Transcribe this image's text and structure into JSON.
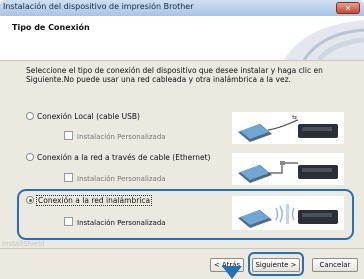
{
  "window": {
    "title": "Instalación del dispositivo de impresión Brother",
    "close_glyph": "✕"
  },
  "header": {
    "title": "Tipo de Conexión"
  },
  "intro": {
    "text": "Seleccione el tipo de conexión del dispositivo que desee instalar y haga clic en Siguiente.No puede usar una red cableada y otra inalámbrica a la vez."
  },
  "options": [
    {
      "label": "Conexión Local (cable USB)",
      "selected": false,
      "custom_label": "Instalación Personalizada",
      "custom_enabled": false,
      "icon": "usb-connection-icon"
    },
    {
      "label": "Conexión a la red a través de cable (Ethernet)",
      "selected": false,
      "custom_label": "Instalación Personalizada",
      "custom_enabled": false,
      "icon": "ethernet-connection-icon"
    },
    {
      "label": "Conexión a la red inalámbrica",
      "selected": true,
      "custom_label": "Instalación Personalizada",
      "custom_enabled": true,
      "icon": "wireless-connection-icon"
    }
  ],
  "footer": {
    "watermark": "InstallShield",
    "back_label": "< Atrás",
    "next_label": "Siguiente >",
    "cancel_label": "Cancelar"
  },
  "colors": {
    "highlight": "#2670b5",
    "radio_dot": "#2a8a2a"
  }
}
